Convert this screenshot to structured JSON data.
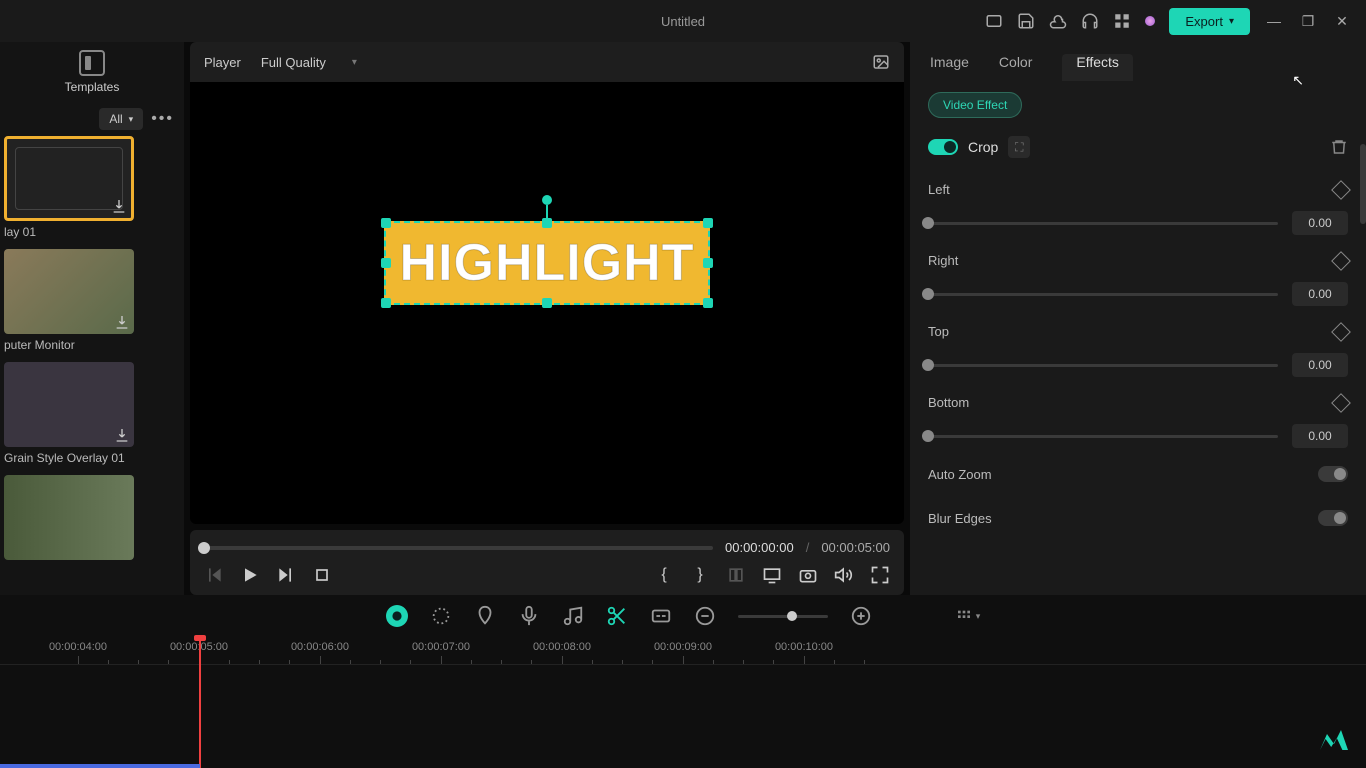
{
  "titlebar": {
    "title": "Untitled",
    "export_label": "Export"
  },
  "left": {
    "templates_label": "Templates",
    "filter_all": "All",
    "items": [
      {
        "caption": "lay 01"
      },
      {
        "caption": "puter Monitor"
      },
      {
        "caption": "Grain Style Overlay 01"
      },
      {
        "caption": ""
      }
    ]
  },
  "player": {
    "label": "Player",
    "quality": "Full Quality",
    "canvas_text": "HIGHLIGHT",
    "time_current": "00:00:00:00",
    "time_total": "00:00:05:00",
    "time_sep": "/"
  },
  "right": {
    "tabs": {
      "image": "Image",
      "color": "Color",
      "effects": "Effects"
    },
    "video_effect_label": "Video Effect",
    "crop_label": "Crop",
    "props": {
      "left": {
        "label": "Left",
        "value": "0.00"
      },
      "right": {
        "label": "Right",
        "value": "0.00"
      },
      "top": {
        "label": "Top",
        "value": "0.00"
      },
      "bottom": {
        "label": "Bottom",
        "value": "0.00"
      }
    },
    "auto_zoom_label": "Auto Zoom",
    "blur_edges_label": "Blur Edges"
  },
  "timeline": {
    "marks": [
      "00:00:04:00",
      "00:00:05:00",
      "00:00:06:00",
      "00:00:07:00",
      "00:00:08:00",
      "00:00:09:00",
      "00:00:10:00"
    ]
  }
}
